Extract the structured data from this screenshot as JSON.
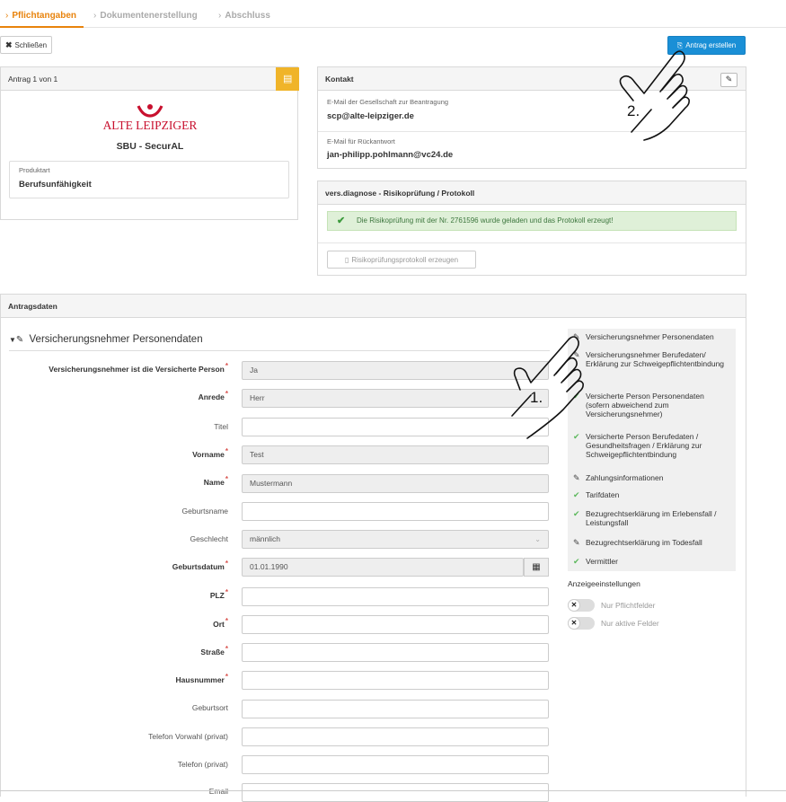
{
  "steps": [
    {
      "label": "Pflichtangaben"
    },
    {
      "label": "Dokumentenerstellung"
    },
    {
      "label": "Abschluss"
    }
  ],
  "toolbar": {
    "close_label": "Schließen",
    "create_label": "Antrag erstellen"
  },
  "product_panel": {
    "header": "Antrag 1 von 1",
    "logo_text": "ALTE LEIPZIGER",
    "product_name": "SBU - SecurAL",
    "type_label": "Produktart",
    "type_value": "Berufsunfähigkeit"
  },
  "contact": {
    "title": "Kontakt",
    "email_company_label": "E-Mail der Gesellschaft zur Beantragung",
    "email_company": "scp@alte-leipziger.de",
    "email_reply_label": "E-Mail für Rückantwort",
    "email_reply": "jan-philipp.pohlmann@vc24.de"
  },
  "risk": {
    "title": "vers.diagnose - Risikoprüfung / Protokoll",
    "message": "Die Risikoprüfung mit der Nr. 2761596 wurde geladen und das Protokoll erzeugt!",
    "button_label": "Risikoprüfungsprotokoll erzeugen"
  },
  "antrag": {
    "title": "Antragsdaten",
    "section_title": "Versicherungsnehmer Personendaten"
  },
  "form": {
    "f1_label": "Versicherungsnehmer ist die Versicherte Person",
    "f1_value": "Ja",
    "f2_label": "Anrede",
    "f2_value": "Herr",
    "f3_label": "Titel",
    "f4_label": "Vorname",
    "f4_value": "Test",
    "f5_label": "Name",
    "f5_value": "Mustermann",
    "f6_label": "Geburtsname",
    "f7_label": "Geschlecht",
    "f7_value": "männlich",
    "f8_label": "Geburtsdatum",
    "f8_value": "01.01.1990",
    "f9_label": "PLZ",
    "f10_label": "Ort",
    "f11_label": "Straße",
    "f12_label": "Hausnummer",
    "f13_label": "Geburtsort",
    "f14_label": "Telefon Vorwahl (privat)",
    "f15_label": "Telefon (privat)",
    "f16_label": "Email"
  },
  "nav": [
    {
      "label": "Versicherungsnehmer Personendaten",
      "state": "edit"
    },
    {
      "label": "Versicherungsnehmer Berufedaten/ Erklärung zur Schweigepflichtentbindung",
      "state": "edit"
    },
    {
      "label": "Versicherte Person Personendaten (sofern abweichend zum Versicherungsnehmer)",
      "state": "done"
    },
    {
      "label": "Versicherte Person Berufedaten / Gesundheitsfragen / Erklärung zur Schweigepflichtentbindung",
      "state": "done"
    },
    {
      "label": "Zahlungsinformationen",
      "state": "edit"
    },
    {
      "label": "Tarifdaten",
      "state": "done"
    },
    {
      "label": "Bezugrechtserklärung im Erlebensfall / Leistungsfall",
      "state": "done"
    },
    {
      "label": "Bezugrechtserklärung im Todesfall",
      "state": "edit"
    },
    {
      "label": "Vermittler",
      "state": "done"
    }
  ],
  "display_settings": {
    "title": "Anzeigeeinstellungen",
    "opt1": "Nur Pflichtfelder",
    "opt2": "Nur aktive Felder"
  },
  "annotations": {
    "a1": "1.",
    "a2": "2."
  },
  "colors": {
    "accent": "#e8830c",
    "primary": "#1a8fd6",
    "success": "#5cb85c",
    "logo_red": "#c8102e"
  }
}
